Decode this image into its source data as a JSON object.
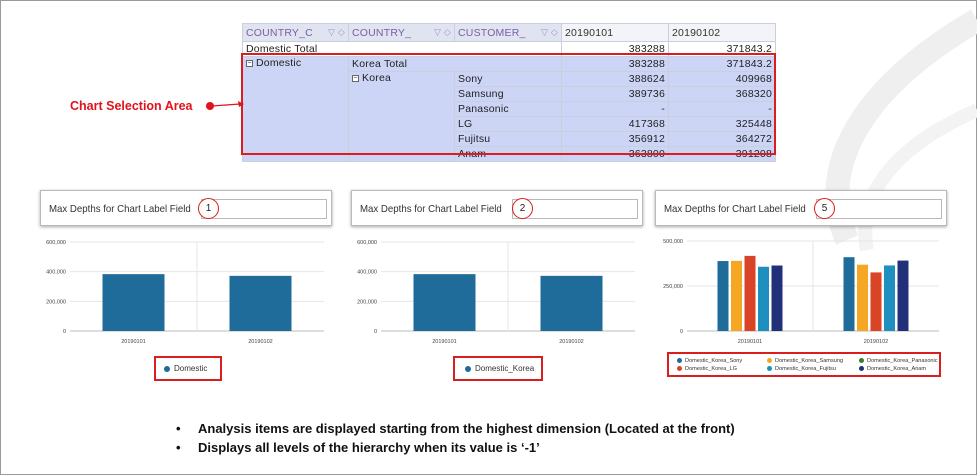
{
  "grid": {
    "headers": [
      "COUNTRY_C",
      "COUNTRY_",
      "CUSTOMER_",
      "20190101",
      "20190102"
    ],
    "domestic_total": {
      "label": "Domestic Total",
      "v1": "383288",
      "v2": "371843.2"
    },
    "domestic_label": "Domestic",
    "korea_total": {
      "label": "Korea Total",
      "v1": "383288",
      "v2": "371843.2"
    },
    "korea_label": "Korea",
    "rows": [
      {
        "customer": "Sony",
        "v1": "388624",
        "v2": "409968"
      },
      {
        "customer": "Samsung",
        "v1": "389736",
        "v2": "368320"
      },
      {
        "customer": "Panasonic",
        "v1": "-",
        "v2": "-"
      },
      {
        "customer": "LG",
        "v1": "417368",
        "v2": "325448"
      },
      {
        "customer": "Fujitsu",
        "v1": "356912",
        "v2": "364272"
      },
      {
        "customer": "Anam",
        "v1": "363800",
        "v2": "391208"
      }
    ]
  },
  "selection_label": "Chart Selection Area",
  "panels": [
    {
      "title": "Max Depths for Chart Label Field",
      "depth": "1"
    },
    {
      "title": "Max Depths for Chart Label Field",
      "depth": "2"
    },
    {
      "title": "Max Depths for Chart Label Field",
      "depth": "5"
    }
  ],
  "colors": {
    "bar": "#1f6b99",
    "sony": "#1f6b99",
    "samsung": "#f5a623",
    "panasonic": "#3a7d2c",
    "lg": "#d94426",
    "fujitsu": "#1e8fbf",
    "anam": "#22307a",
    "selection": "#d81e1e"
  },
  "chart_data": [
    {
      "type": "bar",
      "categories": [
        "20190101",
        "20190102"
      ],
      "series": [
        {
          "name": "Domestic",
          "values": [
            383288,
            371843.2
          ]
        }
      ],
      "yticks": [
        "600,000",
        "400,000",
        "200,000",
        "0"
      ],
      "ylim": [
        0,
        600000
      ],
      "legend": "bottom"
    },
    {
      "type": "bar",
      "categories": [
        "20190101",
        "20190102"
      ],
      "series": [
        {
          "name": "Domestic_Korea",
          "values": [
            383288,
            371843.2
          ]
        }
      ],
      "yticks": [
        "600,000",
        "400,000",
        "200,000",
        "0"
      ],
      "ylim": [
        0,
        600000
      ],
      "legend": "bottom"
    },
    {
      "type": "bar",
      "categories": [
        "20190101",
        "20190102"
      ],
      "series": [
        {
          "name": "Domestic_Korea_Sony",
          "values": [
            388624,
            409968
          ]
        },
        {
          "name": "Domestic_Korea_Samsung",
          "values": [
            389736,
            368320
          ]
        },
        {
          "name": "Domestic_Korea_Panasonic",
          "values": [
            0,
            0
          ]
        },
        {
          "name": "Domestic_Korea_LG",
          "values": [
            417368,
            325448
          ]
        },
        {
          "name": "Domestic_Korea_Fujitsu",
          "values": [
            356912,
            364272
          ]
        },
        {
          "name": "Domestic_Korea_Anam",
          "values": [
            363800,
            391208
          ]
        }
      ],
      "yticks": [
        "500,000",
        "250,000",
        "0"
      ],
      "ylim": [
        0,
        500000
      ],
      "legend": "bottom"
    }
  ],
  "bullets": [
    "Analysis items are displayed starting from the highest dimension (Located at the front)",
    "Displays all levels of the hierarchy when its value is ‘-1’"
  ]
}
